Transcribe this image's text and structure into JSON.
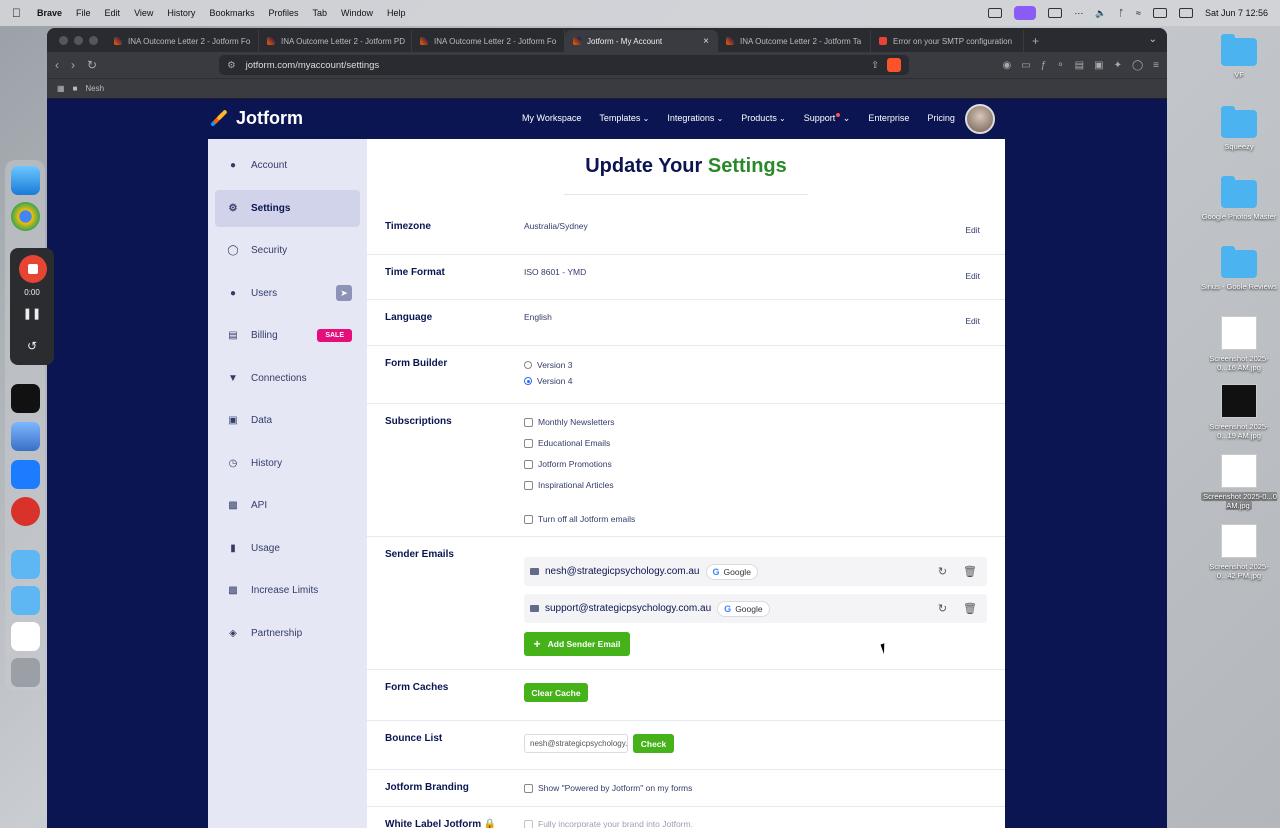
{
  "menubar": {
    "app": "Brave",
    "items": [
      "File",
      "Edit",
      "View",
      "History",
      "Bookmarks",
      "Profiles",
      "Tab",
      "Window",
      "Help"
    ],
    "clock": "Sat Jun 7  12:56"
  },
  "browser": {
    "tabs": [
      {
        "title": "INA Outcome Letter 2 - Jotform Fo"
      },
      {
        "title": "INA Outcome Letter 2 - Jotform PD"
      },
      {
        "title": "INA Outcome Letter 2 - Jotform Fo"
      },
      {
        "title": "Jotform - My Account",
        "close": "×"
      },
      {
        "title": "INA Outcome Letter 2 - Jotform Ta"
      },
      {
        "title": "Error on your SMTP configuration"
      }
    ],
    "new_tab": "+",
    "url": "jotform.com/myaccount/settings",
    "bookmark_folder": "Nesh"
  },
  "recorder": {
    "time": "0:00"
  },
  "jotform": {
    "logo": "Jotform",
    "nav": {
      "workspace": "My Workspace",
      "templates": "Templates",
      "integrations": "Integrations",
      "products": "Products",
      "support": "Support",
      "enterprise": "Enterprise",
      "pricing": "Pricing"
    }
  },
  "sidebar": {
    "items": [
      {
        "label": "Account",
        "icon": "user-icon"
      },
      {
        "label": "Settings",
        "icon": "gear-icon"
      },
      {
        "label": "Security",
        "icon": "shield-icon"
      },
      {
        "label": "Users",
        "icon": "users-icon"
      },
      {
        "label": "Billing",
        "icon": "billing-icon",
        "badge": "SALE"
      },
      {
        "label": "Connections",
        "icon": "plug-icon"
      },
      {
        "label": "Data",
        "icon": "database-icon"
      },
      {
        "label": "History",
        "icon": "clock-icon"
      },
      {
        "label": "API",
        "icon": "api-icon"
      },
      {
        "label": "Usage",
        "icon": "bar-chart-icon"
      },
      {
        "label": "Increase Limits",
        "icon": "gift-icon"
      },
      {
        "label": "Partnership",
        "icon": "handshake-icon"
      }
    ]
  },
  "settings": {
    "title_a": "Update Your",
    "title_b": "Settings",
    "timezone": {
      "label": "Timezone",
      "value": "Australia/Sydney",
      "edit": "Edit"
    },
    "time_format": {
      "label": "Time Format",
      "value": "ISO 8601 - YMD",
      "edit": "Edit"
    },
    "language": {
      "label": "Language",
      "value": "English",
      "edit": "Edit"
    },
    "form_builder": {
      "label": "Form Builder",
      "options": [
        "Version 3",
        "Version 4"
      ],
      "selected": "Version 4"
    },
    "subscriptions": {
      "label": "Subscriptions",
      "options": [
        "Monthly Newsletters",
        "Educational Emails",
        "Jotform Promotions",
        "Inspirational Articles"
      ],
      "turn_off": "Turn off all Jotform emails"
    },
    "sender_emails": {
      "label": "Sender Emails",
      "emails": [
        {
          "address": "nesh@strategicpsychology.com.au",
          "provider": "Google"
        },
        {
          "address": "support@strategicpsychology.com.au",
          "provider": "Google"
        }
      ],
      "add_button": "Add Sender Email"
    },
    "form_caches": {
      "label": "Form Caches",
      "button": "Clear Cache"
    },
    "bounce_list": {
      "label": "Bounce List",
      "input_value": "nesh@strategicpsychology.com.au",
      "button": "Check"
    },
    "branding": {
      "label": "Jotform Branding",
      "option": "Show \"Powered by Jotform\" on my forms"
    },
    "white_label": {
      "label": "White Label Jotform",
      "option": "Fully incorporate your brand into Jotform."
    }
  },
  "desktop": {
    "icons": [
      {
        "label": "VF"
      },
      {
        "label": "Squeezy"
      },
      {
        "label": "Google Photos Master"
      },
      {
        "label": "Sirius - Goole Reviews"
      },
      {
        "label": "Screenshot 2025-0...16 AM.jpg"
      },
      {
        "label": "Screenshot 2025-0...19 AM.jpg"
      },
      {
        "label": "Screenshot 2025-0...0 AM.jpg"
      },
      {
        "label": "Screenshot 2025-0...42 PM.jpg"
      }
    ]
  },
  "colors": {
    "brand_navy": "#0a1551",
    "accent_green": "#45b21a",
    "sale_pink": "#e50f7c"
  }
}
